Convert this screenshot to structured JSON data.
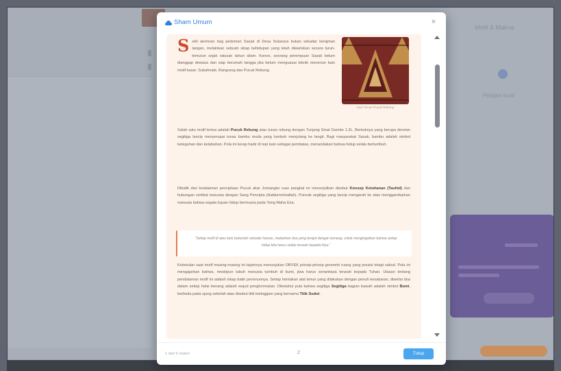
{
  "modal": {
    "title": "Sham Umum",
    "close_glyph": "×",
    "paragraphs": [
      {
        "dropcap": "S",
        "text": "ekil alemnan bag pedoman Sasak di Desa Sukarara bukan sekadar kerajinan tangan, melainkan sebuah sikap kehidupan yang telah diwariskan secara turun-temurun sejak ratusan tahun silam. Konon, seorang perempuan Sasak belum dianggap dewasa dan siap berumah tangga jika belum menguasai teknik menenun kain motif kasar. Subahnale, Rangrang dan Pucuk Rebung."
      },
      {
        "text_a": "Salah satu motif tertua adalah ",
        "bold": "Pucuk Rebung",
        "text_b": " atau tunas rebung dengan Tunjang Sinat Gambe 1.3L. Bentuknya yang berupa deretan segitiga lancip menyerupai tunas bambu muda yang tumbuh menjulang ke langit. Bagi masyarakat Sasak, bambu adalah simbol keteguhan dan ketabahan. Pola ini kerap hadir di tepi kain sebagai pembatas, menandakan bahwa hidup selalu bertumbuh."
      },
      {
        "text_a": "Dibalik dari kedalaman penciptaan Pucuk akar Jomangko ruas pangkal ini menonjolkan disebut ",
        "bold": "Konsep Ketuhanan (Tauhid)",
        "text_b": " dan hubungan vertikal manusia dengan Sang Pencipta (Hablumminallah). Puncak segitiga yang lancip mengarah ke atas menggambarkan manusia bahwa segala tujuan hidup bermuara pada Yang Maha Esa."
      },
      {
        "text_a": "Kebetulan saat motif masing-masing ini tajamnya menunjukan OBYEK prinsip-prinsip geometri ruang yang presisi tetapi sakral. Pola ini mengajarkan bahwa, meskipun tubuh manusia tumbuh di bumi, jiwa harus senantiasa terarah kepada Tuhan. Ulasan tentang pendalaman motif ini adalah sikap batin penenunnya. Setiap hentakan alat tenun yang dilakukan dengan penuh kesabaran, disertai doa dalam setiap helai benang adalah wujud penghormatan. Diketahui pula bahwa segitiga ",
        "bold": "Segitiga",
        "text_b": " bagian bawah adalah simbol ",
        "bold2": "Bumi",
        "text_c": ", berbeda pada ujung sebelah atas disebut titik ketinggian yang bernama ",
        "bold3": "Titik Sudut",
        "text_d": "."
      }
    ],
    "quote": "\"Setiap motif di atas kain bukanlah sekadar hiasan, melainkan doa yang terajut dengan benang, untuk mengingatkan bahwa setiap hidup kita harus selalu terarah kepada-Nya.\"",
    "figure_caption": "Kain Tenun Pucuk Rebung",
    "footer_left": "1 dari 6 materi",
    "footer_mid": "2",
    "ok_label": "Tutup"
  },
  "background": {
    "right_title": "Motif & Makna",
    "right_small": "Pelajari motif"
  },
  "colors": {
    "accent": "#2f80d9",
    "dropcap": "#d04a2e",
    "content_bg": "#fdf3ea",
    "ok_button": "#4aa6ef"
  },
  "icons": {
    "header": "cloud-icon",
    "close": "close-icon",
    "scroll_up": "chevron-up-icon",
    "scroll_down": "chevron-down-icon"
  }
}
